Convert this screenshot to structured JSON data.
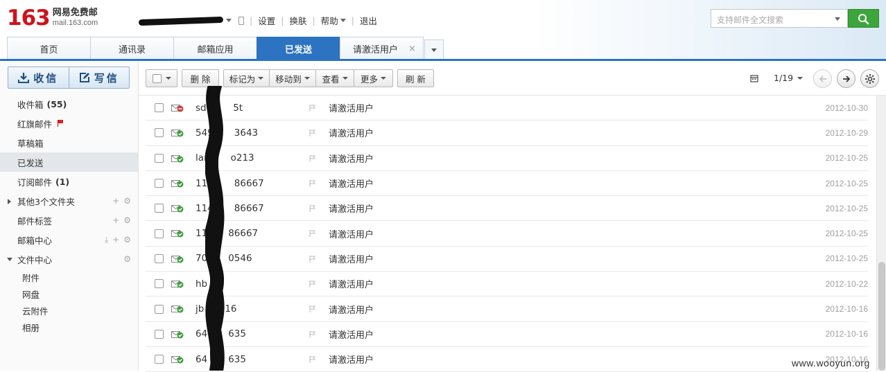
{
  "logo": {
    "number": "163",
    "name": "网易免费邮",
    "url": "mail.163.com"
  },
  "userbar": {
    "links": [
      "设置",
      "换肤",
      "帮助",
      "退出"
    ]
  },
  "search": {
    "placeholder": "支持邮件全文搜索"
  },
  "tabs": [
    {
      "label": "首页"
    },
    {
      "label": "通讯录"
    },
    {
      "label": "邮箱应用"
    },
    {
      "label": "已发送"
    },
    {
      "label": "请激活用户",
      "close": "×"
    }
  ],
  "compose": {
    "receive": "收信",
    "write": "写信"
  },
  "nav": {
    "inbox": {
      "label": "收件箱",
      "count": "(55)"
    },
    "flagged": "红旗邮件",
    "drafts": "草稿箱",
    "sent": "已发送",
    "subscribed": {
      "label": "订阅邮件",
      "count": "(1)"
    },
    "other_folders": "其他3个文件夹",
    "tags": "邮件标签",
    "mailbox_center": "邮箱中心",
    "file_center": "文件中心",
    "file_sub": [
      "附件",
      "网盘",
      "云附件",
      "相册"
    ]
  },
  "toolbar": {
    "delete": "删 除",
    "mark_as": "标记为",
    "move_to": "移动到",
    "view": "查看",
    "more": "更多",
    "refresh": "刷 新",
    "page": "1/19"
  },
  "emails": [
    {
      "sender": "sd4",
      "sender_tail": "5t",
      "subject": "请激活用户",
      "date": "2012-10-30",
      "status": "failed"
    },
    {
      "sender": "549",
      "sender_tail": "3643",
      "subject": "请激活用户",
      "date": "2012-10-29",
      "status": "sent"
    },
    {
      "sender": "lan",
      "sender_tail": "o213",
      "subject": "请激活用户",
      "date": "2012-10-25",
      "status": "sent"
    },
    {
      "sender": "114",
      "sender_tail": "86667",
      "subject": "请激活用户",
      "date": "2012-10-25",
      "status": "sent"
    },
    {
      "sender": "114",
      "sender_tail": "86667",
      "subject": "请激活用户",
      "date": "2012-10-25",
      "status": "sent"
    },
    {
      "sender": "11",
      "sender_tail": "86667",
      "subject": "请激活用户",
      "date": "2012-10-25",
      "status": "sent"
    },
    {
      "sender": "70",
      "sender_tail": "0546",
      "subject": "请激活用户",
      "date": "2012-10-25",
      "status": "sent"
    },
    {
      "sender": "hb",
      "sender_tail": "",
      "subject": "请激活用户",
      "date": "2012-10-22",
      "status": "sent"
    },
    {
      "sender": "jb",
      "sender_tail": "16",
      "subject": "请激活用户",
      "date": "2012-10-16",
      "status": "sent"
    },
    {
      "sender": "64",
      "sender_tail": "635",
      "subject": "请激活用户",
      "date": "2012-10-16",
      "status": "sent"
    },
    {
      "sender": "64",
      "sender_tail": "635",
      "subject": "请激活用户",
      "date": "2012-10-16",
      "status": "sent"
    }
  ],
  "watermark": "www.wooyun.org",
  "colors": {
    "brand_red": "#d0121b",
    "accent_blue": "#2c73c1",
    "search_green": "#3ca63c",
    "sent_green": "#3aa03a",
    "failed_red": "#d23a3a"
  }
}
